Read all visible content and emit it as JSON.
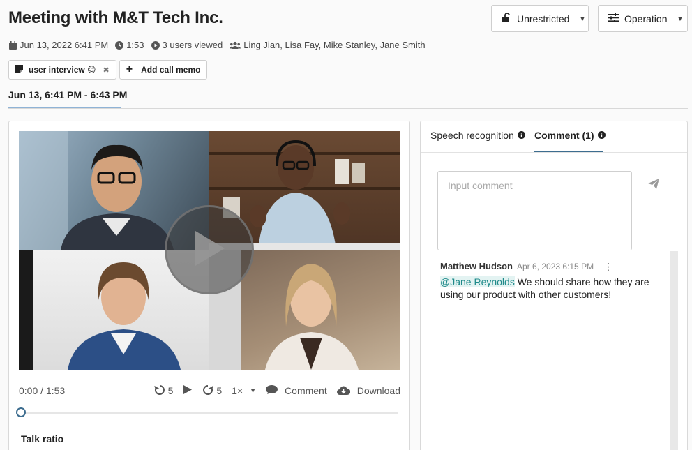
{
  "header": {
    "title": "Meeting with M&T Tech Inc.",
    "access_button": "Unrestricted",
    "operation_button": "Operation"
  },
  "meta": {
    "date": "Jun 13, 2022 6:41 PM",
    "duration": "1:53",
    "views": "3 users viewed",
    "participants": "Ling Jian, Lisa Fay, Mike Stanley, Jane Smith"
  },
  "chips": {
    "tag_label": "user interview 😊",
    "add_memo": "Add call memo"
  },
  "range_tab": "Jun 13, 6:41 PM - 6:43 PM",
  "player": {
    "time": "0:00 / 1:53",
    "rewind": "5",
    "forward": "5",
    "speed": "1×",
    "comment": "Comment",
    "download": "Download",
    "progress": 0
  },
  "talk_ratio": "Talk ratio",
  "tabs": {
    "speech": "Speech recognition",
    "comment": "Comment (1)"
  },
  "comment_input": {
    "placeholder": "Input comment"
  },
  "comments": [
    {
      "author": "Matthew Hudson",
      "date": "Apr 6, 2023 6:15 PM",
      "mention": "@Jane Reynolds",
      "text": " We should share how they are using our product with other customers!"
    }
  ],
  "colors": {
    "accent": "#3d6d8f",
    "mention": "#1f8a8a"
  }
}
